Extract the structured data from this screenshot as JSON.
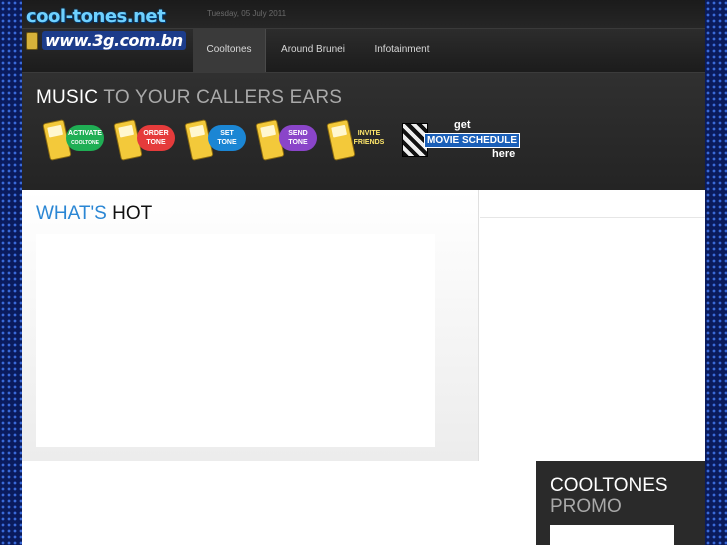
{
  "header": {
    "date": "Tuesday, 05 July 2011",
    "logo_line1": "cool-tones.net",
    "logo_line2": "www.3g.com.bn"
  },
  "nav": {
    "items": [
      {
        "label": "Cooltones",
        "active": true
      },
      {
        "label": "Around Brunei",
        "active": false
      },
      {
        "label": "Infotainment",
        "active": false
      }
    ]
  },
  "banner": {
    "tagline_part1": "MUSIC",
    "tagline_part2": "TO YOUR CALLERS EARS",
    "buttons": [
      {
        "line1": "ACTIVATE",
        "line2": "COOLTONE",
        "color": "#1fae54"
      },
      {
        "line1": "ORDER",
        "line2": "TONE",
        "color": "#e53b3b"
      },
      {
        "line1": "SET",
        "line2": "TONE",
        "color": "#1b86d4"
      },
      {
        "line1": "SEND",
        "line2": "TONE",
        "color": "#8a45c9"
      },
      {
        "line1": "INVITE",
        "line2": "FRIENDS",
        "color": "transparent"
      }
    ],
    "movie": {
      "line1": "get",
      "line2": "MOVIE SCHEDULE",
      "line3": "here"
    }
  },
  "whats_hot": {
    "title_part1": "WHAT'S",
    "title_part2": "HOT"
  },
  "promo": {
    "title_part1": "COOLTONES",
    "title_part2": "PROMO"
  }
}
